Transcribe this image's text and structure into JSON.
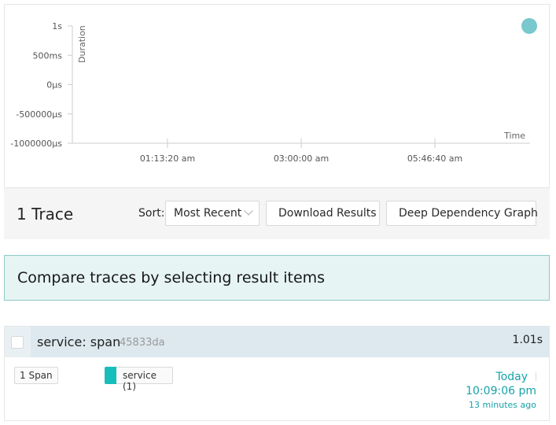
{
  "chart_data": {
    "type": "scatter",
    "ylabel": "Duration",
    "xlabel": "Time",
    "y_ticks": [
      "1s",
      "500ms",
      "0μs",
      "-500000μs",
      "-1000000μs"
    ],
    "x_ticks": [
      "01:13:20 am",
      "03:00:00 am",
      "05:46:40 am"
    ],
    "points": [
      {
        "x": "10:09:06 pm",
        "y": "1.01s"
      }
    ],
    "colors": {
      "point": "#78c8cd"
    }
  },
  "results": {
    "count_label": "1 Trace",
    "sort_label": "Sort:",
    "sort_value": "Most Recent",
    "download_label": "Download Results",
    "ddg_label": "Deep Dependency Graph"
  },
  "compare_banner": "Compare traces by selecting result items",
  "trace": {
    "title": "service: span",
    "trace_id": "45833da",
    "duration": "1.01s",
    "span_count": "1 Span",
    "service_tag": "service (1)",
    "service_color": "#17bebb",
    "day": "Today",
    "time": "10:09:06 pm",
    "ago": "13 minutes ago"
  }
}
